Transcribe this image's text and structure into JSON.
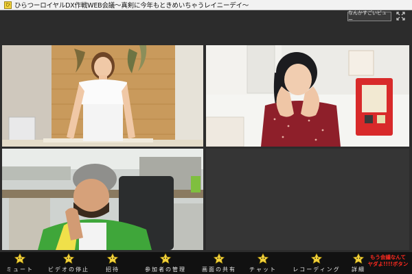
{
  "window": {
    "title": "ひらつーロイヤルDX作戦WEB会議〜真剣に今年もときめいちゃうレイニーデイ〜",
    "app_icon_glyph": "ひ"
  },
  "header": {
    "view_button_label": "なんかすごいビュー"
  },
  "participants": [
    {
      "tile": "participant-tile-1",
      "icon": "video-feed"
    },
    {
      "tile": "participant-tile-2",
      "icon": "video-feed"
    },
    {
      "tile": "participant-tile-3",
      "icon": "video-feed"
    },
    {
      "tile": "empty-tile",
      "icon": ""
    }
  ],
  "toolbar": {
    "items": [
      {
        "label": "ミュート",
        "icon": "mute-icon"
      },
      {
        "label": "ビデオの停止",
        "icon": "stop-video-icon"
      },
      {
        "label": "招待",
        "icon": "invite-icon"
      },
      {
        "label": "参加者の管理",
        "icon": "participants-icon"
      },
      {
        "label": "画面の共有",
        "icon": "share-screen-icon"
      },
      {
        "label": "チャット",
        "icon": "chat-icon"
      },
      {
        "label": "レコーディング",
        "icon": "record-icon"
      },
      {
        "label": "詳細",
        "icon": "more-icon"
      }
    ],
    "end_button_line1": "もう会議なんて",
    "end_button_line2": "ヤダよ!!!!ボタン"
  },
  "colors": {
    "titlebar": "#f2f2f2",
    "background": "#2c2c2c",
    "toolbar": "#111111",
    "end_button_text": "#ff2a1f",
    "mascot_yellow": "#f3d23b"
  }
}
